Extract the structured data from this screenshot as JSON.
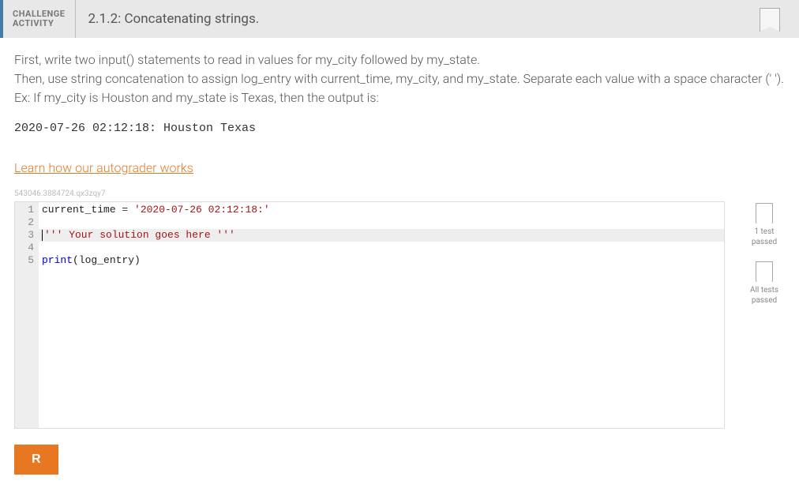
{
  "header": {
    "label_line1": "CHALLENGE",
    "label_line2": "ACTIVITY",
    "title": "2.1.2: Concatenating strings."
  },
  "instructions": {
    "line1": "First, write two input() statements to read in values for my_city followed by my_state.",
    "line2": "Then, use string concatenation to assign log_entry with current_time, my_city, and my_state. Separate each value with a space character (' ').",
    "line3": "Ex: If my_city is Houston and my_state is Texas, then the output is:"
  },
  "example_output": "2020-07-26 02:12:18: Houston Texas",
  "autograder_link": "Learn how our autograder works",
  "hash_id": "543046.3884724.qx3zqy7",
  "code": {
    "line_numbers": [
      "1",
      "2",
      "3",
      "4",
      "5"
    ],
    "line1_a": "current_time ",
    "line1_b": "= ",
    "line1_c": "'2020-07-26 02:12:18:'",
    "line3": "''' Your solution goes here '''",
    "line5_a": "print",
    "line5_b": "(log_entry)"
  },
  "status": {
    "test1": "1 test passed",
    "test_all": "All tests passed"
  },
  "run_label": "R"
}
